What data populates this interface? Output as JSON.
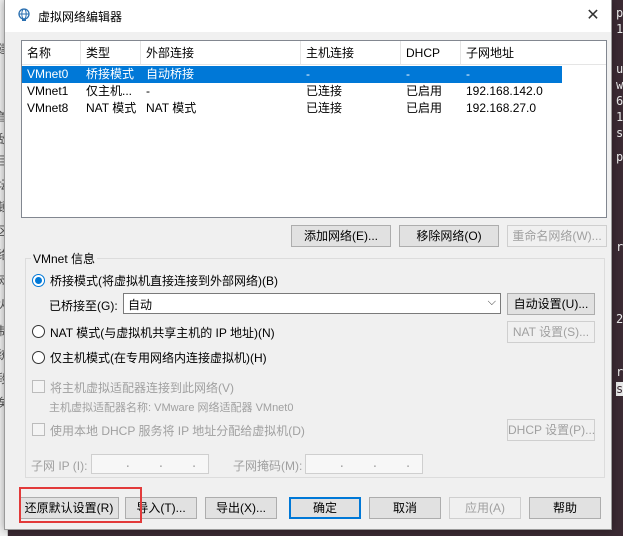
{
  "window": {
    "title": "虚拟网络编辑器",
    "close_glyph": "✕"
  },
  "list": {
    "columns": [
      "名称",
      "类型",
      "外部连接",
      "主机连接",
      "DHCP",
      "子网地址"
    ],
    "rows": [
      {
        "name": "VMnet0",
        "type": "桥接模式",
        "external": "自动桥接",
        "host": "-",
        "dhcp": "-",
        "subnet": "-"
      },
      {
        "name": "VMnet1",
        "type": "仅主机...",
        "external": "-",
        "host": "已连接",
        "dhcp": "已启用",
        "subnet": "192.168.142.0"
      },
      {
        "name": "VMnet8",
        "type": "NAT 模式",
        "external": "NAT 模式",
        "host": "已连接",
        "dhcp": "已启用",
        "subnet": "192.168.27.0"
      }
    ],
    "selected_index": 0
  },
  "list_buttons": {
    "add": "添加网络(E)...",
    "remove": "移除网络(O)",
    "rename": "重命名网络(W)..."
  },
  "vmnet_info": {
    "group_label": "VMnet 信息",
    "bridged_label": "桥接模式(将虚拟机直接连接到外部网络)(B)",
    "bridged_to_label": "已桥接至(G):",
    "bridged_to_value": "自动",
    "auto_settings": "自动设置(U)...",
    "nat_label": "NAT 模式(与虚拟机共享主机的 IP 地址)(N)",
    "nat_settings": "NAT 设置(S)...",
    "host_only_label": "仅主机模式(在专用网络内连接虚拟机)(H)",
    "connect_adapter_label": "将主机虚拟适配器连接到此网络(V)",
    "adapter_name_label": "主机虚拟适配器名称: VMware 网络适配器 VMnet0",
    "dhcp_label": "使用本地 DHCP 服务将 IP 地址分配给虚拟机(D)",
    "dhcp_settings": "DHCP 设置(P)...",
    "subnet_ip_label": "子网 IP (I):",
    "subnet_ip_value": "    .    .    .",
    "subnet_mask_label": "子网掩码(M):",
    "subnet_mask_value": "    .    .    ."
  },
  "footer_buttons": {
    "restore_defaults": "还原默认设置(R)",
    "import": "导入(T)...",
    "export": "导出(X)...",
    "ok": "确定",
    "cancel": "取消",
    "apply": "应用(A)",
    "help": "帮助"
  },
  "colors": {
    "selection": "#0078d7",
    "highlight_box": "#e23a3a"
  },
  "background": {
    "terminal_chars": [
      "p",
      "1",
      "u",
      "w",
      "6",
      "1",
      "s",
      "p",
      "r",
      "2",
      "r",
      "s"
    ],
    "left_chars": [
      "建",
      "首",
      "敌",
      "目",
      "坛",
      "顿",
      "区",
      "络",
      "网",
      "火",
      "制",
      "统",
      "段",
      "矣"
    ]
  }
}
